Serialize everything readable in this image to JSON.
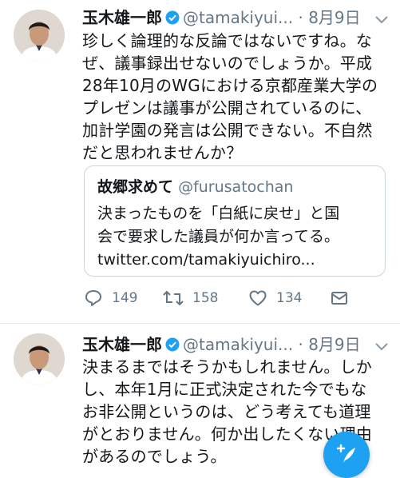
{
  "tweets": [
    {
      "author": {
        "name": "玉木雄一郎",
        "handle": "@tamakiyui...",
        "verified": true
      },
      "separator_dot": "·",
      "date": "8月9日",
      "text_lines": [
        "珍しく論理的な反論ではないですね。な",
        "ぜ、議事録出せないのでしょうか。平成",
        "28年10月のWGにおける京都産業大学の",
        "プレゼンは議事が公開されているのに、",
        "加計学園の発言は公開できない。不自然",
        "だと思われませんか？"
      ],
      "quoted_tweet": {
        "name": "故郷求めて",
        "handle": "@furusatochan",
        "text_lines": [
          "決まったものを「白紙に戻せ」と国",
          "会で要求した議員が何か言ってる。",
          "twitter.com/tamakiyuichiro..."
        ]
      },
      "actions": {
        "reply_count": "149",
        "retweet_count": "158",
        "like_count": "134"
      }
    },
    {
      "author": {
        "name": "玉木雄一郎",
        "handle": "@tamakiyui...",
        "verified": true
      },
      "separator_dot": "·",
      "date": "8月9日",
      "text_lines": [
        "決まるまではそうかもしれません。しか",
        "し、本年1月に正式決定された今でもな",
        "お非公開というのは、どう考えても道理",
        "がとおりません。何か出したくない理由",
        "があるのでしょう。"
      ]
    }
  ],
  "icons": {
    "verified": "verified-badge-icon",
    "menu": "chevron-down-icon",
    "reply": "reply-icon",
    "retweet": "retweet-icon",
    "like": "heart-icon",
    "dm": "envelope-icon",
    "compose": "compose-tweet-icon"
  },
  "colors": {
    "accent": "#1da1f2",
    "secondary_text": "#657786",
    "border": "#ccd6dd"
  }
}
